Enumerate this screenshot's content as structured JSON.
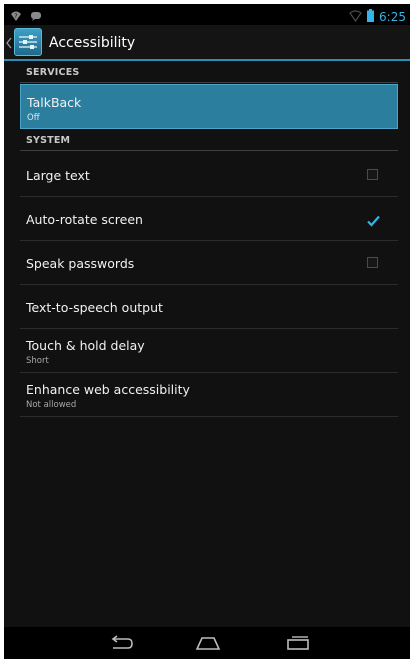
{
  "action_bar": {
    "title": "Accessibility",
    "icon": "accessibility-settings-icon"
  },
  "status_bar": {
    "time": "6:25",
    "left_icons": [
      "wifi-question-icon",
      "notification-icon"
    ],
    "right_icons": [
      "signal-icon",
      "battery-icon"
    ],
    "accent": "#33b5e5"
  },
  "sections": {
    "services": {
      "header": "SERVICES",
      "items": [
        {
          "title": "TalkBack",
          "summary": "Off",
          "selected": true
        }
      ]
    },
    "system": {
      "header": "SYSTEM",
      "items": [
        {
          "title": "Large text",
          "checkbox": true,
          "checked": false
        },
        {
          "title": "Auto-rotate screen",
          "checkbox": true,
          "checked": true
        },
        {
          "title": "Speak passwords",
          "checkbox": true,
          "checked": false
        },
        {
          "title": "Text-to-speech output"
        },
        {
          "title": "Touch & hold delay",
          "summary": "Short"
        },
        {
          "title": "Enhance web accessibility",
          "summary": "Not allowed"
        }
      ]
    }
  },
  "nav_bar": {
    "buttons": [
      "back-icon",
      "home-icon",
      "recent-apps-icon"
    ]
  },
  "colors": {
    "selected_row": "#2b7e9e",
    "checkmark": "#33b5e5",
    "action_bar_divider": "#2f8fb3"
  }
}
